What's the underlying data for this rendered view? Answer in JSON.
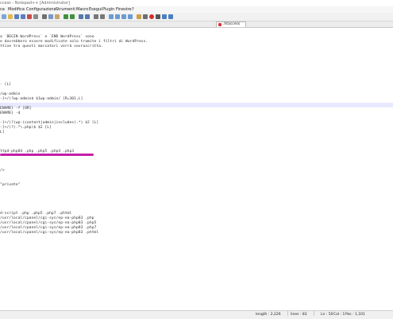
{
  "window": {
    "title": "ccess - Notepad++ [Administrator]"
  },
  "menu": {
    "items": [
      "ca",
      "Modifica",
      "Configurazione",
      "Strumenti",
      "Macro",
      "Esegui",
      "Plugin",
      "Finestre",
      "?"
    ]
  },
  "toolbar": {
    "icons": [
      "new-icon",
      "open-icon",
      "save-icon",
      "save-all-icon",
      "close-icon",
      "print-icon",
      "cut-icon",
      "copy-icon",
      "paste-icon",
      "undo-icon",
      "redo-icon",
      "find-icon",
      "replace-icon",
      "zoom-in-icon",
      "zoom-out-icon",
      "sync-icon",
      "wrap-icon",
      "indent-guide-icon",
      "show-all-icon",
      "highlight-icon",
      "run-icon",
      "record-icon",
      "stop-icon",
      "play-icon",
      "save-macro-icon"
    ]
  },
  "tabs": [
    {
      "label": ".htaccess",
      "active": true,
      "accent": "#dd3333"
    }
  ],
  "editor": {
    "lines": [
      "a `BEGIN WordPress` e `END WordPress` sono",
      "e dovrebbero essere modificate solo tramite i filtri di WordPress.",
      "ttive tra questi marcatori verrà sovrascritta.",
      "",
      "",
      "",
      "",
      "",
      "",
      "",
      "- [L]",
      "",
      "/wp-admin",
      "-]+/)?wp-admin$ $1wp-admin/ [R=301,L]",
      "",
      "ENAME} -f [OR]",
      "ENAME} -d",
      "",
      "-]+/)?(wp-(content|admin|includes).*) $2 [L]",
      "-]+/)?(.*\\.php)$ $2 [L]",
      "L]",
      "",
      "",
      "",
      "ttpd-php84 .php .php5 .php4 .php3",
      "",
      "",
      "",
      "/>",
      "",
      "",
      "\"private\"",
      "",
      "",
      "",
      "",
      "",
      "d-script .php .php5 .php7 .phtml",
      "/usr/local/cpanel/cgi-sys/ep-ea-php83 .php",
      "/usr/local/cpanel/cgi-sys/ep-ea-php83 .php5",
      "/usr/local/cpanel/cgi-sys/ep-ea-php83 .php7",
      "/usr/local/cpanel/cgi-sys/ep-ea-php83 .phtml"
    ],
    "current_line_highlight": "#e8e8ff",
    "annotation_color": "#c21fa8"
  },
  "status": {
    "length": "length : 2,226",
    "lines": "lines : 83",
    "position": "Ln : 50",
    "col": "Col : 1",
    "pos": "Pos : 1,101"
  }
}
